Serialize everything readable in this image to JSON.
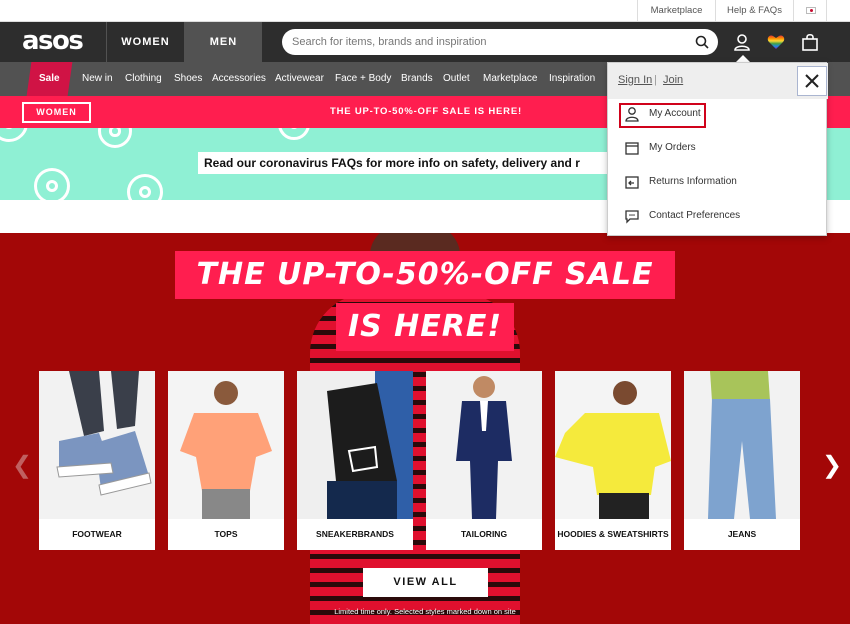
{
  "utility_bar": {
    "marketplace": "Marketplace",
    "help": "Help & FAQs"
  },
  "header": {
    "logo": "asos",
    "tab_women": "WOMEN",
    "tab_men": "MEN",
    "search_placeholder": "Search for items, brands and inspiration"
  },
  "nav": {
    "items": [
      "Sale",
      "New in",
      "Clothing",
      "Shoes",
      "Accessories",
      "Activewear",
      "Face + Body",
      "Brands",
      "Outlet",
      "Marketplace",
      "Inspiration"
    ]
  },
  "promo": {
    "button": "WOMEN",
    "text": "THE UP-TO-50%-OFF SALE IS HERE!"
  },
  "covid_banner": "Read our coronavirus FAQs for more info on safety, delivery and r",
  "hero": {
    "headline_1": "THE UP-TO-50%-OFF SALE",
    "headline_2": "IS HERE!",
    "categories": [
      "FOOTWEAR",
      "TOPS",
      "SNEAKERBRANDS",
      "TAILORING",
      "HOODIES & SWEATSHIRTS",
      "JEANS"
    ],
    "view_all": "VIEW ALL",
    "fine_print": "Limited time only. Selected styles marked down on site"
  },
  "account_menu": {
    "sign_in": "Sign In",
    "separator": "|",
    "join": "Join",
    "items": [
      "My Account",
      "My Orders",
      "Returns Information",
      "Contact Preferences"
    ]
  },
  "colors": {
    "header_bg": "#2d2d2d",
    "nav_bg": "#525252",
    "sale_red": "#d01345",
    "promo_pink": "#ff1e4f",
    "mint": "#8ff0d4",
    "hero_red": "#a30707",
    "highlight_red": "#d0021b"
  },
  "icons": [
    "search-icon",
    "account-icon",
    "wishlist-heart-icon",
    "bag-icon",
    "close-icon",
    "user-icon",
    "box-icon",
    "returns-icon",
    "chat-icon",
    "chevron-left-icon",
    "chevron-right-icon"
  ]
}
